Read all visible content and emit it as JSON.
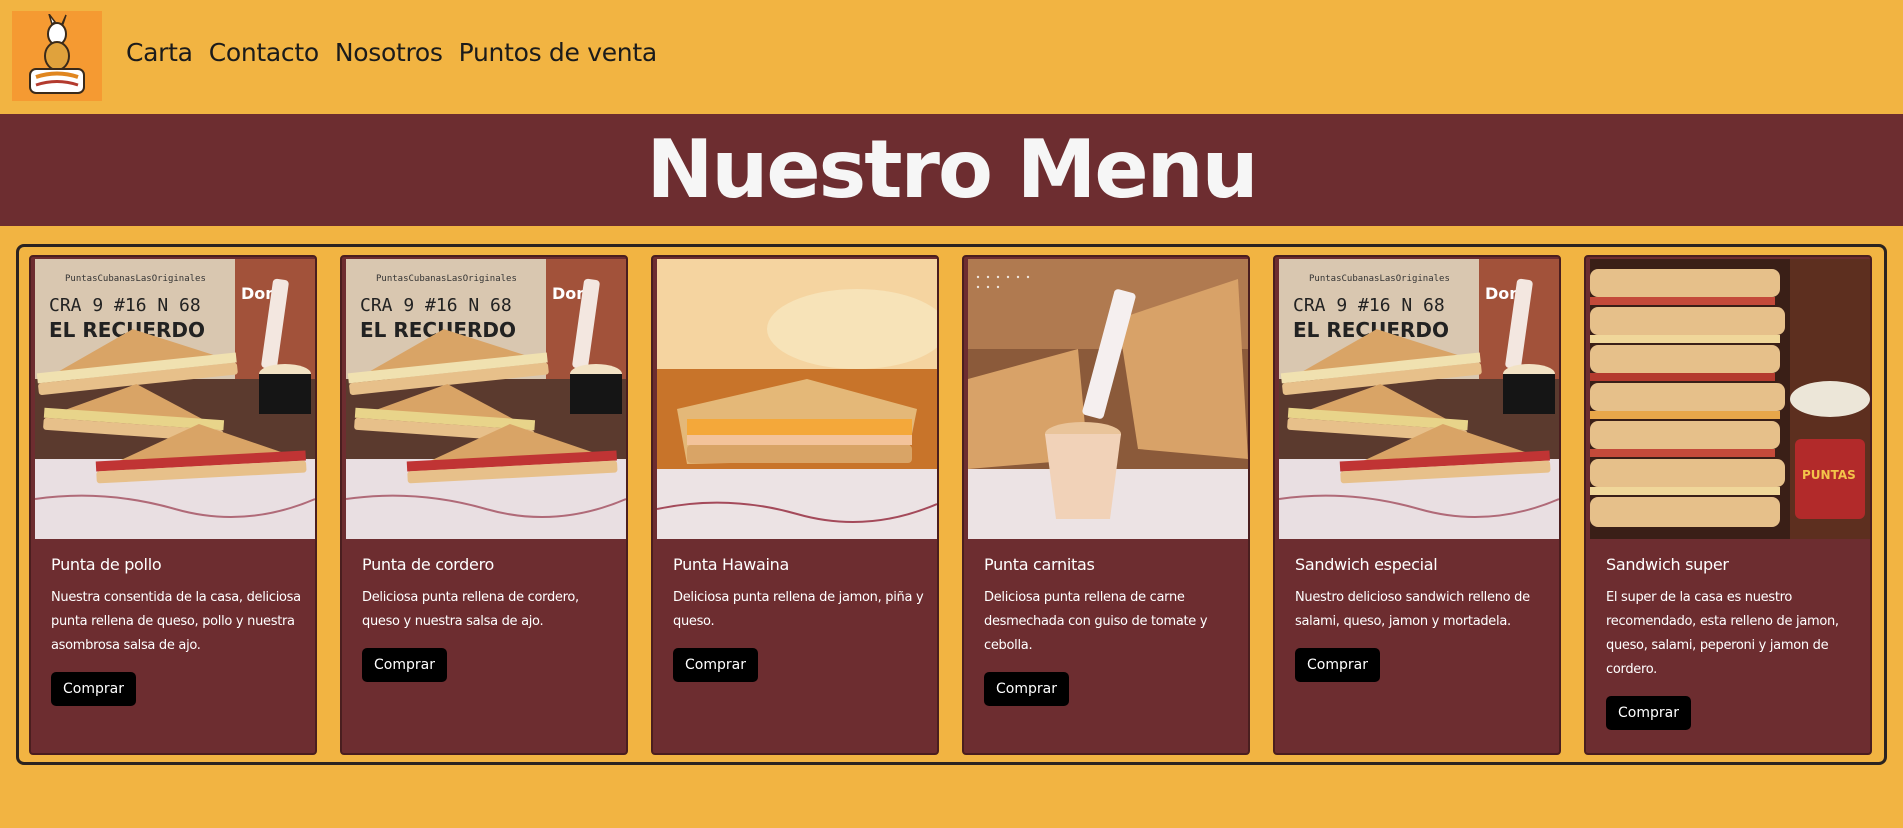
{
  "header": {
    "logo_alt": "Puntas Cubanas",
    "nav": [
      {
        "label": "Carta"
      },
      {
        "label": "Contacto"
      },
      {
        "label": "Nosotros"
      },
      {
        "label": "Puntos de venta"
      }
    ]
  },
  "banner": {
    "title": "Nuestro Menu"
  },
  "menu": {
    "items": [
      {
        "name": "Punta de pollo",
        "description": "Nuestra consentida de la casa, deliciosa punta rellena de queso, pollo y nuestra asombrosa salsa de ajo.",
        "button": "Comprar",
        "photo": "sandwich-stack-sign"
      },
      {
        "name": "Punta de cordero",
        "description": "Deliciosa punta rellena de cordero, queso y nuestra salsa de ajo.",
        "button": "Comprar",
        "photo": "sandwich-stack-sign"
      },
      {
        "name": "Punta Hawaina",
        "description": "Deliciosa punta rellena de jamon, piña y queso.",
        "button": "Comprar",
        "photo": "sandwich-pineapple"
      },
      {
        "name": "Punta carnitas",
        "description": "Deliciosa punta rellena de carne desmechada con guiso de tomate y cebolla.",
        "button": "Comprar",
        "photo": "sandwich-sauce-cup"
      },
      {
        "name": "Sandwich especial",
        "description": "Nuestro delicioso sandwich relleno de salami, queso, jamon y mortadela.",
        "button": "Comprar",
        "photo": "sandwich-stack-sign"
      },
      {
        "name": "Sandwich super",
        "description": "El super de la casa es nuestro recomendado, esta relleno de jamon, queso, salami, peperoni y jamon de cordero.",
        "button": "Comprar",
        "photo": "sandwich-tower"
      }
    ]
  },
  "photo_sign": {
    "handle": "PuntasCubanasLasOriginales",
    "line1": "CRA 9 #16 N 68",
    "line2": "EL RECUERDO",
    "brand": "Domi"
  },
  "colors": {
    "background": "#f2b442",
    "banner": "#6d2d30",
    "card": "#6d2d30",
    "button": "#000000",
    "logo_bg": "#f59a32"
  }
}
